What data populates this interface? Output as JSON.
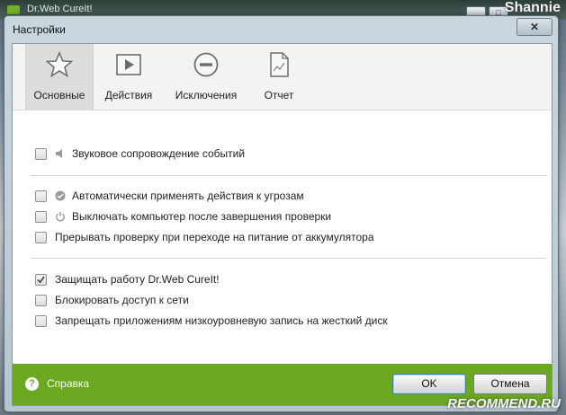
{
  "background": {
    "app_title": "Dr.Web CureIt!",
    "watermark_top": "Shannie",
    "watermark_bottom": "RECOMMEND.RU"
  },
  "dialog": {
    "title": "Настройки",
    "close_label": "✕"
  },
  "tabs": [
    {
      "label": "Основные",
      "icon": "star-icon",
      "active": true
    },
    {
      "label": "Действия",
      "icon": "play-icon",
      "active": false
    },
    {
      "label": "Исключения",
      "icon": "minus-circle-icon",
      "active": false
    },
    {
      "label": "Отчет",
      "icon": "report-document-icon",
      "active": false
    }
  ],
  "options": {
    "group1": [
      {
        "label": "Звуковое сопровождение событий",
        "checked": false,
        "icon": "speaker-icon"
      }
    ],
    "group2": [
      {
        "label": "Автоматически применять действия к угрозам",
        "checked": false,
        "icon": "check-circle-icon"
      },
      {
        "label": "Выключать компьютер после завершения проверки",
        "checked": false,
        "icon": "power-icon"
      },
      {
        "label": "Прерывать проверку при переходе на питание от аккумулятора",
        "checked": false,
        "icon": ""
      }
    ],
    "group3": [
      {
        "label": "Защищать работу Dr.Web CureIt!",
        "checked": true,
        "icon": ""
      },
      {
        "label": "Блокировать доступ к сети",
        "checked": false,
        "icon": ""
      },
      {
        "label": "Запрещать приложениям низкоуровневую запись на жесткий диск",
        "checked": false,
        "icon": ""
      }
    ]
  },
  "footer": {
    "help_label": "Справка",
    "ok_label": "OK",
    "cancel_label": "Отмена"
  },
  "colors": {
    "footer_green": "#6aa81f",
    "active_tab": "#dcdcdc"
  }
}
